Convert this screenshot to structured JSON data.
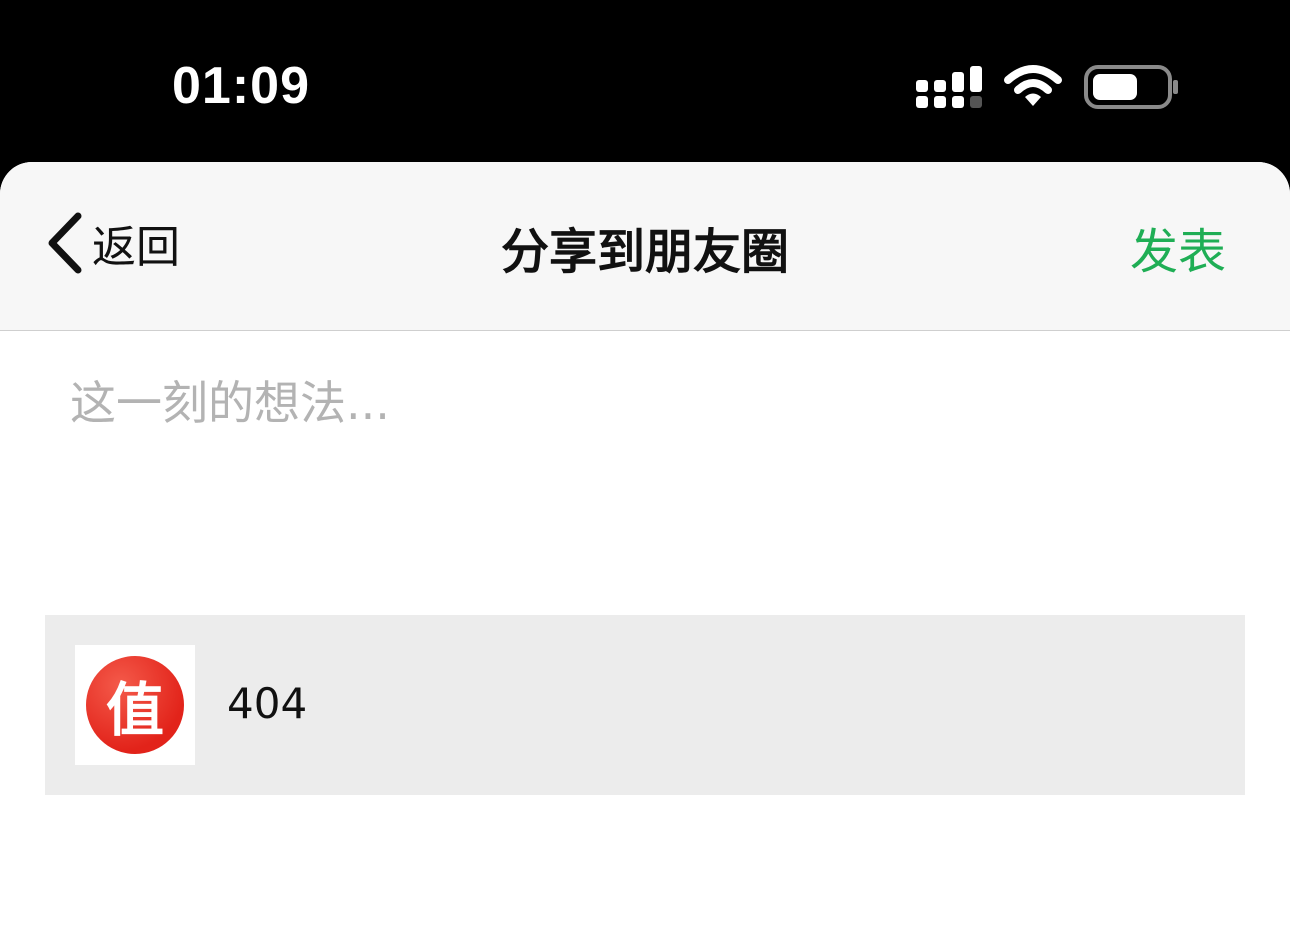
{
  "status_bar": {
    "time": "01:09",
    "signal_icon": "cellular-signal-icon",
    "wifi_icon": "wifi-icon",
    "battery_icon": "battery-icon"
  },
  "nav": {
    "back_icon": "chevron-left-icon",
    "back_label": "返回",
    "title": "分享到朋友圈",
    "publish_label": "发表",
    "publish_color": "#1fae55"
  },
  "compose": {
    "placeholder": "这一刻的想法...",
    "value": ""
  },
  "link_card": {
    "thumbnail_glyph": "值",
    "thumbnail_color": "#e2231a",
    "title": "404"
  }
}
